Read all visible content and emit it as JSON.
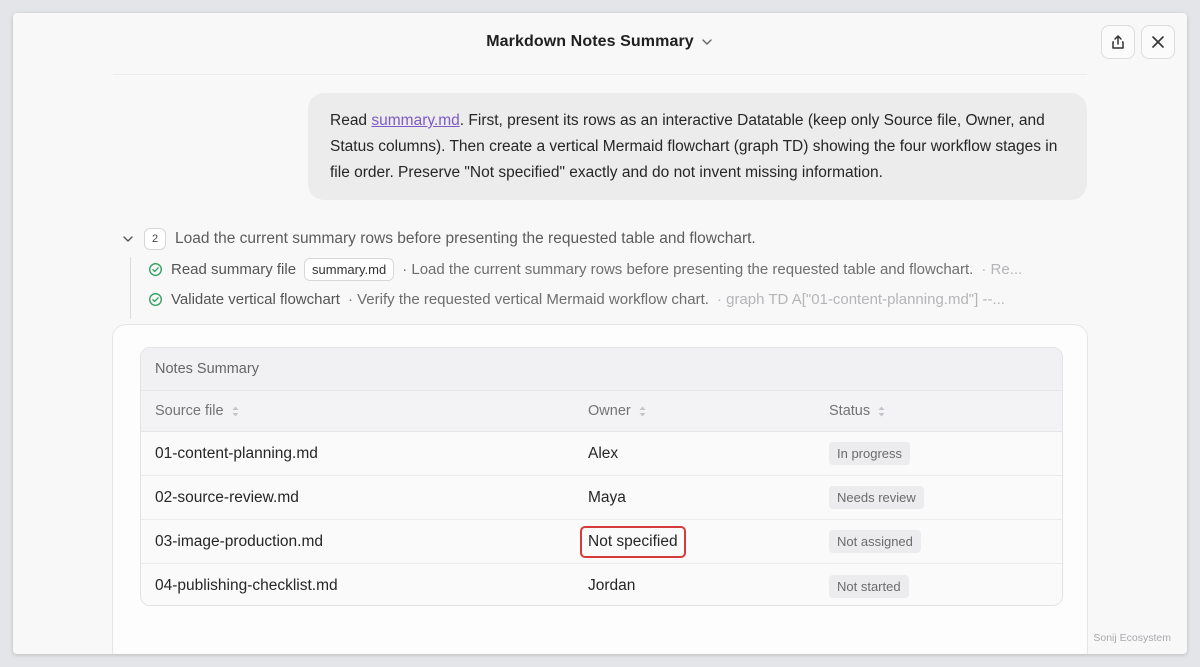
{
  "header": {
    "title": "Markdown Notes Summary",
    "title_icon": "chevron-down-icon",
    "share_icon": "share-icon",
    "close_icon": "close-icon"
  },
  "message": {
    "text_before_link": "Read ",
    "link": "summary.md",
    "text_after_link": ". First, present its rows as an interactive Datatable (keep only Source file, Owner, and Status columns). Then create a vertical Mermaid flowchart (graph TD) showing the four workflow stages in file order. Preserve \"Not specified\" exactly and do not invent missing information."
  },
  "tools": {
    "count": "2",
    "title": "Load the current summary rows before presenting the requested table and flowchart.",
    "steps": [
      {
        "label": "Read summary file",
        "chip": "summary.md",
        "desc": "· Load the current summary rows before presenting the requested table and flowchart.",
        "extra": "· Re..."
      },
      {
        "label": "Validate vertical flowchart",
        "chip": "",
        "desc": " · Verify the requested vertical Mermaid workflow chart.",
        "extra": "· graph TD A[\"01-content-planning.md\"] --..."
      }
    ]
  },
  "table": {
    "caption": "Notes Summary",
    "columns": [
      "Source file",
      "Owner",
      "Status"
    ],
    "rows": [
      {
        "source": "01-content-planning.md",
        "owner": "Alex",
        "status": "In progress"
      },
      {
        "source": "02-source-review.md",
        "owner": "Maya",
        "status": "Needs review"
      },
      {
        "source": "03-image-production.md",
        "owner": "Not specified",
        "status": "Not assigned"
      },
      {
        "source": "04-publishing-checklist.md",
        "owner": "Jordan",
        "status": "Not started"
      }
    ]
  },
  "colors": {
    "highlight": "#d63b3b",
    "link": "#7e5bc4",
    "check": "#2e9e5b"
  },
  "watermark": "Sonij Ecosystem"
}
